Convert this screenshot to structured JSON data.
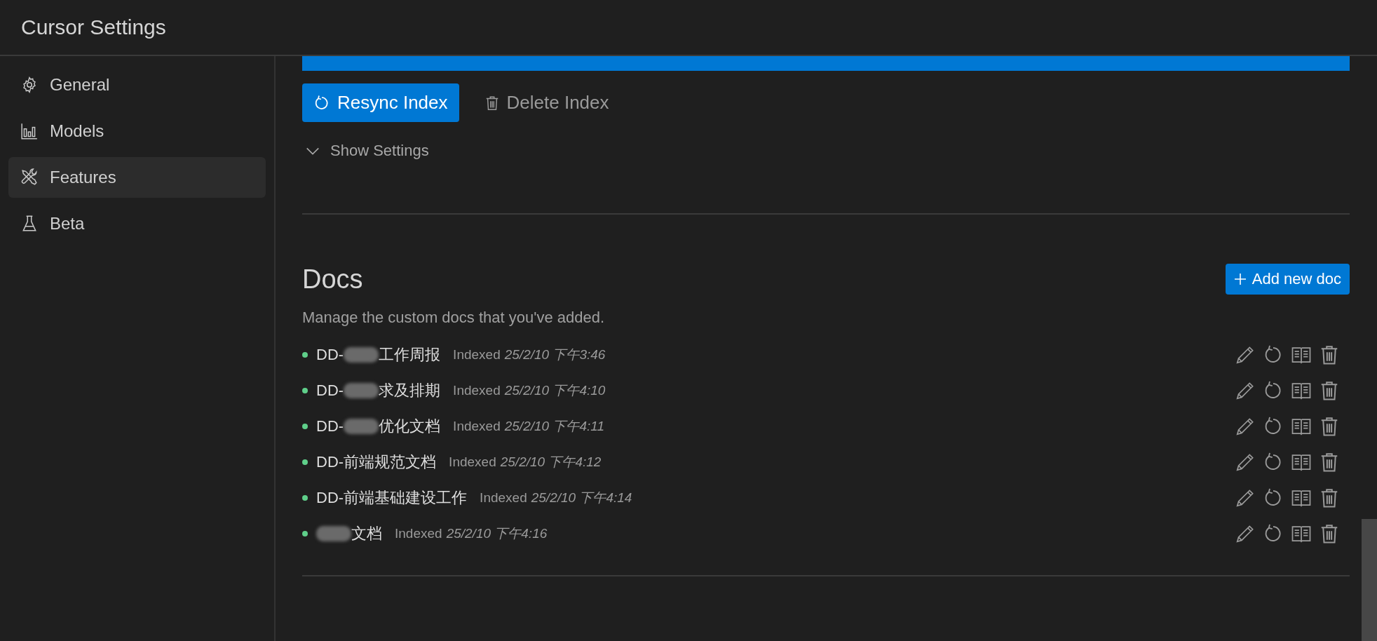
{
  "window": {
    "title": "Cursor Settings"
  },
  "sidebar": {
    "items": [
      {
        "label": "General",
        "selected": false
      },
      {
        "label": "Models",
        "selected": false
      },
      {
        "label": "Features",
        "selected": true
      },
      {
        "label": "Beta",
        "selected": false
      }
    ]
  },
  "index": {
    "progress": {
      "level": 1
    },
    "buttons": [
      {
        "label": "Resync Index",
        "kind": "primary"
      },
      {
        "label": "Delete Index",
        "kind": "plain"
      }
    ],
    "show_settings": {
      "label": "Show Settings",
      "expanded": false
    }
  },
  "docs": {
    "title": "Docs",
    "add_button": "Add new doc",
    "description": "Manage the custom docs that you've added.",
    "items": [
      {
        "name_before": "DD-",
        "redacted": true,
        "name_after": "工作周报",
        "status": "Indexed",
        "time": "25/2/10 下午3:46"
      },
      {
        "name_before": "DD-",
        "redacted": true,
        "name_after": "求及排期",
        "status": "Indexed",
        "time": "25/2/10 下午4:10"
      },
      {
        "name_before": "DD-",
        "redacted": true,
        "name_after": "优化文档",
        "status": "Indexed",
        "time": "25/2/10 下午4:11"
      },
      {
        "name_before": "DD-前端规范文档",
        "redacted": false,
        "status": "Indexed",
        "time": "25/2/10 下午4:12"
      },
      {
        "name_before": "DD-前端基础建设工作",
        "redacted": false,
        "status": "Indexed",
        "time": "25/2/10 下午4:14"
      },
      {
        "redacted": true,
        "name_after": "文档",
        "status": "Indexed",
        "time": "25/2/10 下午4:16"
      }
    ]
  }
}
